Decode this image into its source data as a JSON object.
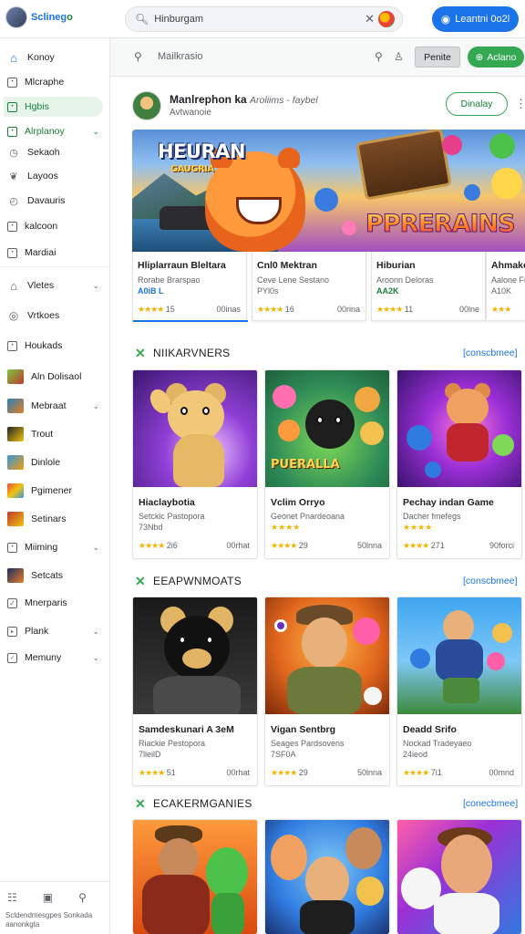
{
  "app": {
    "name_part1": "Sclineg",
    "name_part2": "o"
  },
  "topbar": {
    "search_value": "Hinburgam",
    "signin_label": "Leantni 0o2l"
  },
  "sidebar": {
    "items": [
      {
        "label": "Konoy",
        "icon": "home-icon"
      },
      {
        "label": "Mlcraphe",
        "icon": "box-icon"
      },
      {
        "label": "Hgbis",
        "icon": "box-icon"
      },
      {
        "label": "Alrplanoy",
        "icon": "box-icon"
      },
      {
        "label": "Sekaoh",
        "icon": "clock-icon"
      },
      {
        "label": "Layoos",
        "icon": "leaf-icon"
      },
      {
        "label": "Davauris",
        "icon": "clock-icon"
      },
      {
        "label": "kalcoon",
        "icon": "box-icon"
      },
      {
        "label": "Mardiai",
        "icon": "box-icon"
      },
      {
        "label": "Vletes",
        "icon": "home-icon"
      },
      {
        "label": "Vrtkoes",
        "icon": "circle-icon"
      },
      {
        "label": "Houkads",
        "icon": "box-icon"
      },
      {
        "label": "Aln Dolisaol",
        "icon": "game-thumb-icon"
      },
      {
        "label": "Mebraat",
        "icon": "game-thumb-icon"
      },
      {
        "label": "Trout",
        "icon": "game-thumb-icon"
      },
      {
        "label": "Dinlole",
        "icon": "game-thumb-icon"
      },
      {
        "label": "Pgimener",
        "icon": "game-thumb-icon"
      },
      {
        "label": "Setinars",
        "icon": "game-thumb-icon"
      },
      {
        "label": "Miiming",
        "icon": "box-icon"
      },
      {
        "label": "Setcats",
        "icon": "game-thumb-icon"
      },
      {
        "label": "Mnerparis",
        "icon": "check-icon"
      },
      {
        "label": "Plank",
        "icon": "box-icon"
      },
      {
        "label": "Memuny",
        "icon": "box-icon"
      }
    ],
    "footer": "Scldendmesgpes Sonkada aanonkgta"
  },
  "subbar": {
    "search_text": "Mailkrasio",
    "grey_button": "Penite",
    "green_button": "Aclano"
  },
  "publisher": {
    "name": "Manlrephon ka",
    "name_suffix": "Aroliims - faybel",
    "meta": "Avtwanoie",
    "follow_label": "Dinalay"
  },
  "banner": {
    "logo_line1": "HEURAN",
    "logo_line2": "GAUGRIA",
    "big_text": "PPRERAINS"
  },
  "featured": [
    {
      "title": "Hliplarraun Bleltara",
      "sub1": "Rorabe Brarspao",
      "sub2": "A0iB L",
      "sub2_style": "blue",
      "rating": "15",
      "price": "00inas"
    },
    {
      "title": "Cnl0 Mektran",
      "sub1": "Ceve Lene Sestano",
      "sub2": "PYl0s",
      "sub2_style": "",
      "rating": "16",
      "price": "00rina"
    },
    {
      "title": "Hiburian",
      "sub1": "Aroonn Deloras",
      "sub2": "AA2K",
      "sub2_style": "green",
      "rating": "11",
      "price": "00lne"
    },
    {
      "title": "Ahmake",
      "sub1": "Aalone Frus",
      "sub2": "A10K",
      "sub2_style": "",
      "rating": "",
      "price": ""
    }
  ],
  "sections": [
    {
      "title": "NIIKARVNERS",
      "see_more": "[conscbmee]",
      "cards": [
        {
          "title": "Hiaclaybotia",
          "sub1": "Setckic Pastopora",
          "sub2": "73Nbd",
          "rating": "2i6",
          "price": "00rhat"
        },
        {
          "title": "Vclim Orryo",
          "sub1": "Geonet Pnardeoana",
          "sub2": "",
          "rating": "29",
          "price": "50lnna"
        },
        {
          "title": "Pechay indan Game",
          "sub1": "Dacher fmefegs",
          "sub2": "",
          "rating": "271",
          "price": "90forci"
        }
      ]
    },
    {
      "title": "EEAPWNMOATS",
      "see_more": "[conscbmee]",
      "cards": [
        {
          "title": "Samdeskunari A 3eM",
          "sub1": "Riackie Pestopora",
          "sub2": "7lleilD",
          "rating": "51",
          "price": "00rhat"
        },
        {
          "title": "Vigan Sentbrg",
          "sub1": "Seages Pardsovens",
          "sub2": "7SF0A",
          "rating": "29",
          "price": "50lnna"
        },
        {
          "title": "Deadd Srifo",
          "sub1": "Nockad Tradeyaeo",
          "sub2": "24ieod",
          "rating": "7i1",
          "price": "00mnd"
        }
      ]
    },
    {
      "title": "ECAKERMGANIES",
      "see_more": "[conecbmee]",
      "cards": []
    }
  ],
  "colors": {
    "accent_blue": "#1a73e8",
    "accent_green": "#34a853",
    "star": "#f4b400"
  }
}
